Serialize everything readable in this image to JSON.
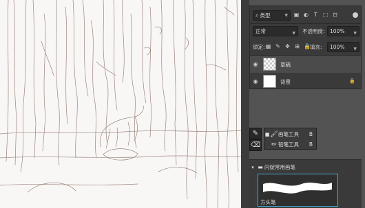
{
  "layers_panel": {
    "filter": {
      "icon": "search-icon",
      "label": "类型",
      "icons": [
        "image-filter-icon",
        "adjustment-filter-icon",
        "type-filter-icon",
        "shape-filter-icon",
        "smart-object-filter-icon"
      ]
    },
    "blend_mode": "正常",
    "opacity_label": "不透明度:",
    "opacity_value": "100%",
    "lock_label": "锁定:",
    "lock_icons": [
      "lock-transparency-icon",
      "lock-image-icon",
      "lock-position-icon",
      "lock-artboard-icon",
      "lock-all-icon"
    ],
    "fill_label": "填充:",
    "fill_value": "100%",
    "layers": [
      {
        "name": "草稿",
        "thumb": "checker",
        "selected": true,
        "locked": false
      },
      {
        "name": "背景",
        "thumb": "white",
        "selected": false,
        "locked": true
      }
    ]
  },
  "tool_panel": {
    "items": [
      {
        "label": "画笔工具",
        "shortcut": "B",
        "icon": "brush-icon",
        "active": true
      },
      {
        "label": "铅笔工具",
        "shortcut": "B",
        "icon": "pencil-icon",
        "active": false
      }
    ]
  },
  "brush_presets": {
    "group_label": "闪绽常用画笔",
    "brush_name": "方头笔"
  },
  "colors": {
    "panel_bg": "#3a3a3a",
    "app_bg": "#535353",
    "selection_border": "#3fb1d8",
    "sketch_stroke": "#8a7168"
  }
}
